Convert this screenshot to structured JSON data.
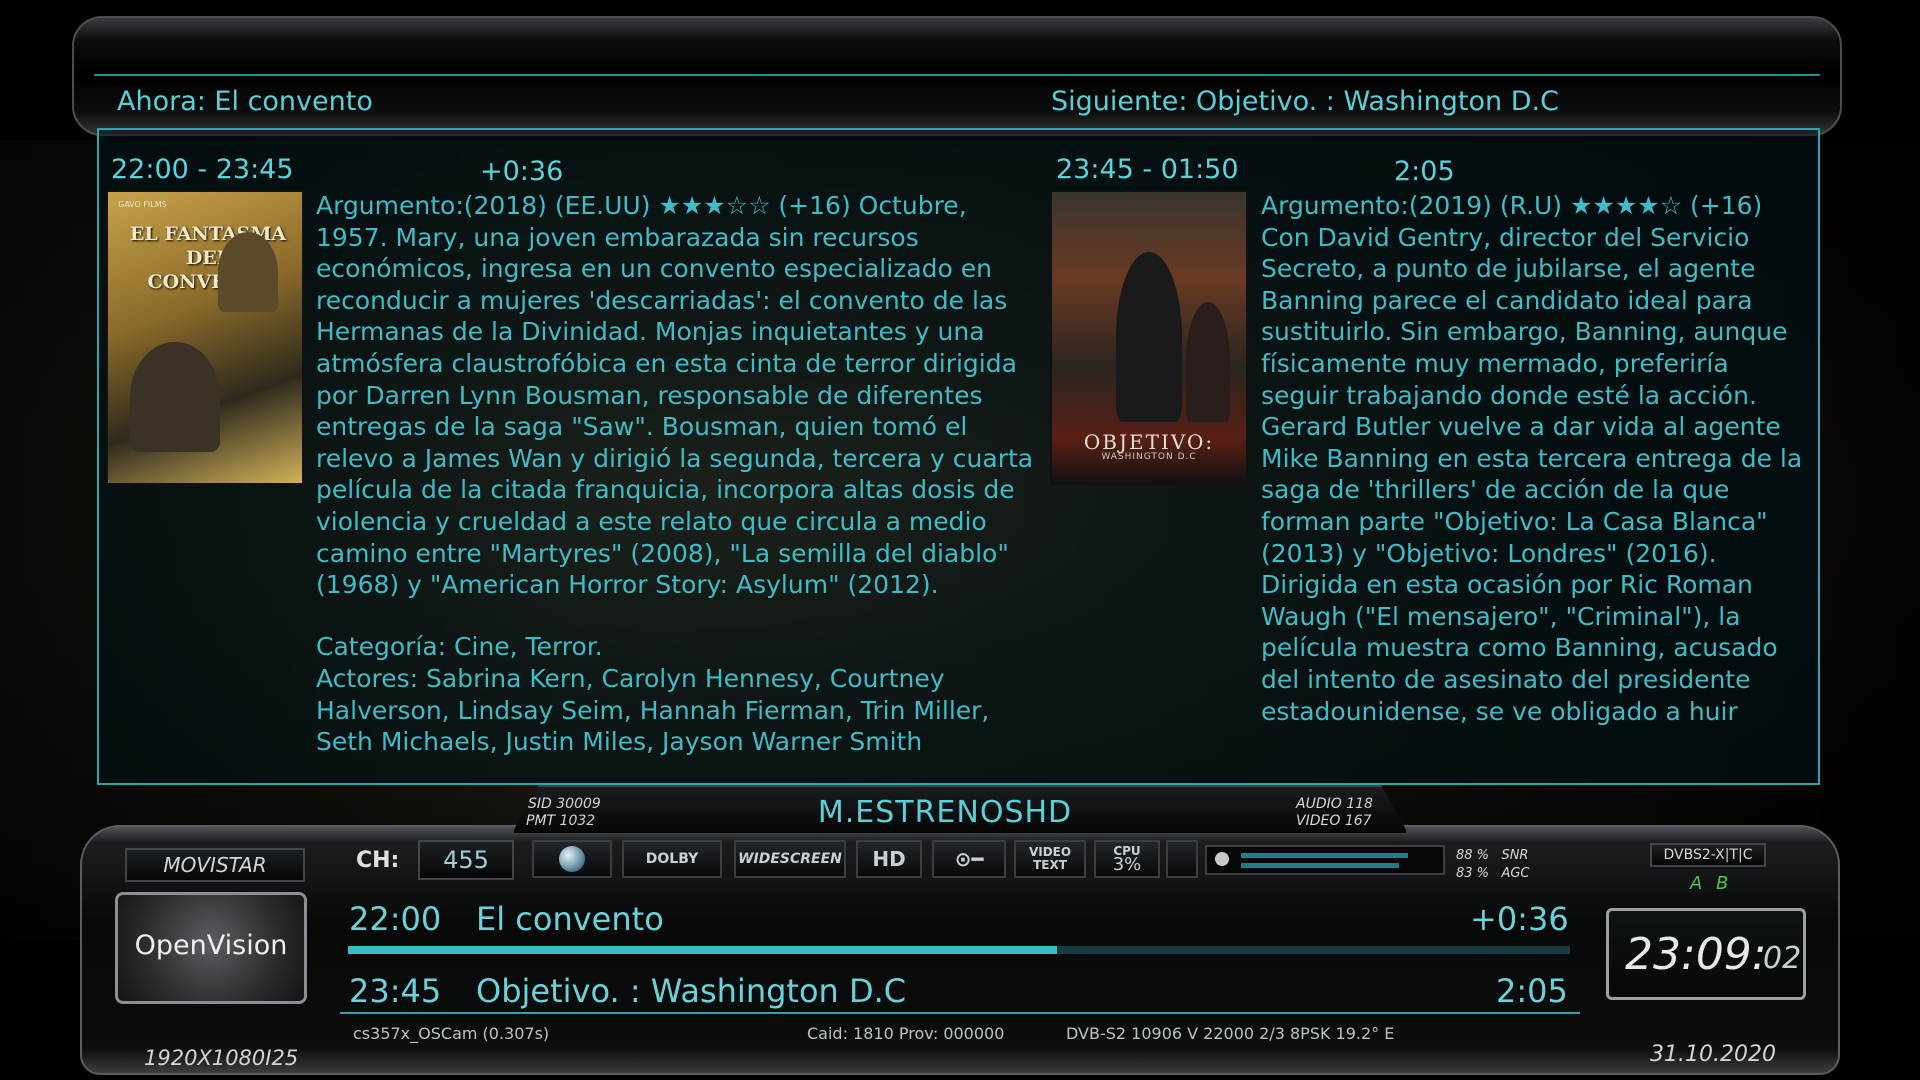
{
  "header": {
    "now_label": "Ahora: El convento",
    "next_label": "Siguiente: Objetivo. : Washington D.C"
  },
  "current": {
    "time": "22:00 - 23:45",
    "remaining": "+0:36",
    "poster_title": "EL FANTASMA DEL CONVENIO",
    "poster_studio": "GAVO FILMS",
    "description": "Argumento:(2018) (EE.UU) ★★★☆☆ (+16) Octubre, 1957. Mary, una joven embarazada sin recursos económicos, ingresa en un convento especializado en reconducir a mujeres 'descarriadas': el convento de las Hermanas de la Divinidad. Monjas inquietantes y una atmósfera claustrofóbica en esta cinta de terror dirigida por Darren Lynn Bousman, responsable de diferentes entregas de la saga \"Saw\". Bousman, quien tomó el relevo a James Wan y dirigió la segunda, tercera y cuarta película de la citada franquicia, incorpora altas dosis de violencia y crueldad a este relato que circula a medio camino entre \"Martyres\" (2008), \"La semilla del diablo\" (1968) y \"American Horror Story: Asylum\" (2012).",
    "category": "Categoría: Cine, Terror.",
    "actors": "Actores: Sabrina Kern, Carolyn Hennesy, Courtney Halverson, Lindsay Seim, Hannah Fierman, Trin Miller, Seth Michaels, Justin Miles, Jayson Warner Smith"
  },
  "next": {
    "time": "23:45 - 01:50",
    "duration": "2:05",
    "poster_title": "OBJETIVO:",
    "poster_subtitle": "WASHINGTON D.C",
    "description": "Argumento:(2019) (R.U) ★★★★☆ (+16) Con David Gentry, director del Servicio Secreto, a punto de jubilarse, el agente Banning parece el candidato ideal para sustituirlo. Sin embargo, Banning, aunque físicamente muy mermado, preferiría seguir trabajando donde esté la acción. Gerard Butler vuelve a dar vida al agente Mike Banning en esta tercera entrega de la saga de 'thrillers' de acción de la que forman parte \"Objetivo: La Casa Blanca\" (2013) y \"Objetivo: Londres\" (2016). Dirigida en esta ocasión por Ric Roman Waugh (\"El mensajero\", \"Criminal\"), la película muestra como Banning, acusado del intento de asesinato del presidente estadounidense, se ve obligado a huir"
  },
  "channel": {
    "name": "M.ESTRENOSHD",
    "sid_label": "SID",
    "sid": "30009",
    "pmt_label": "PMT",
    "pmt": "1032",
    "audio_label": "AUDIO",
    "audio": "118",
    "video_label": "VIDEO",
    "video": "167",
    "provider": "MOVISTAR",
    "ch_label": "CH:",
    "number": "455",
    "logo_text": "OpenVision"
  },
  "badges": {
    "dolby": "DOLBY",
    "widescreen": "WIDESCREEN",
    "hd": "HD",
    "videotext_1": "VIDEO",
    "videotext_2": "TEXT",
    "cpu_label": "CPU",
    "cpu": "3%",
    "snr_value": "88 %",
    "snr_label": "SNR",
    "agc_value": "83 %",
    "agc_label": "AGC"
  },
  "signal": {
    "snr": 0.88,
    "agc": 0.83
  },
  "tuner": {
    "types": "DVBS2-X|T|C",
    "slots": "A B"
  },
  "epg": {
    "now_time": "22:00",
    "now_title": "El convento",
    "now_remaining": "+0:36",
    "progress": 0.58,
    "next_time": "23:45",
    "next_title": "Objetivo. : Washington D.C",
    "next_duration": "2:05"
  },
  "clock": {
    "hm": "23:09:",
    "sec": "02"
  },
  "footer": {
    "resolution": "1920X1080I25",
    "cam": "cs357x_OSCam (0.307s)",
    "caid": "Caid: 1810 Prov: 000000",
    "transponder": "DVB-S2 10906 V 22000 2/3 8PSK 19.2° E",
    "date": "31.10.2020"
  },
  "colors": {
    "accent": "#2aa7b0",
    "text": "#5ad4dc"
  }
}
